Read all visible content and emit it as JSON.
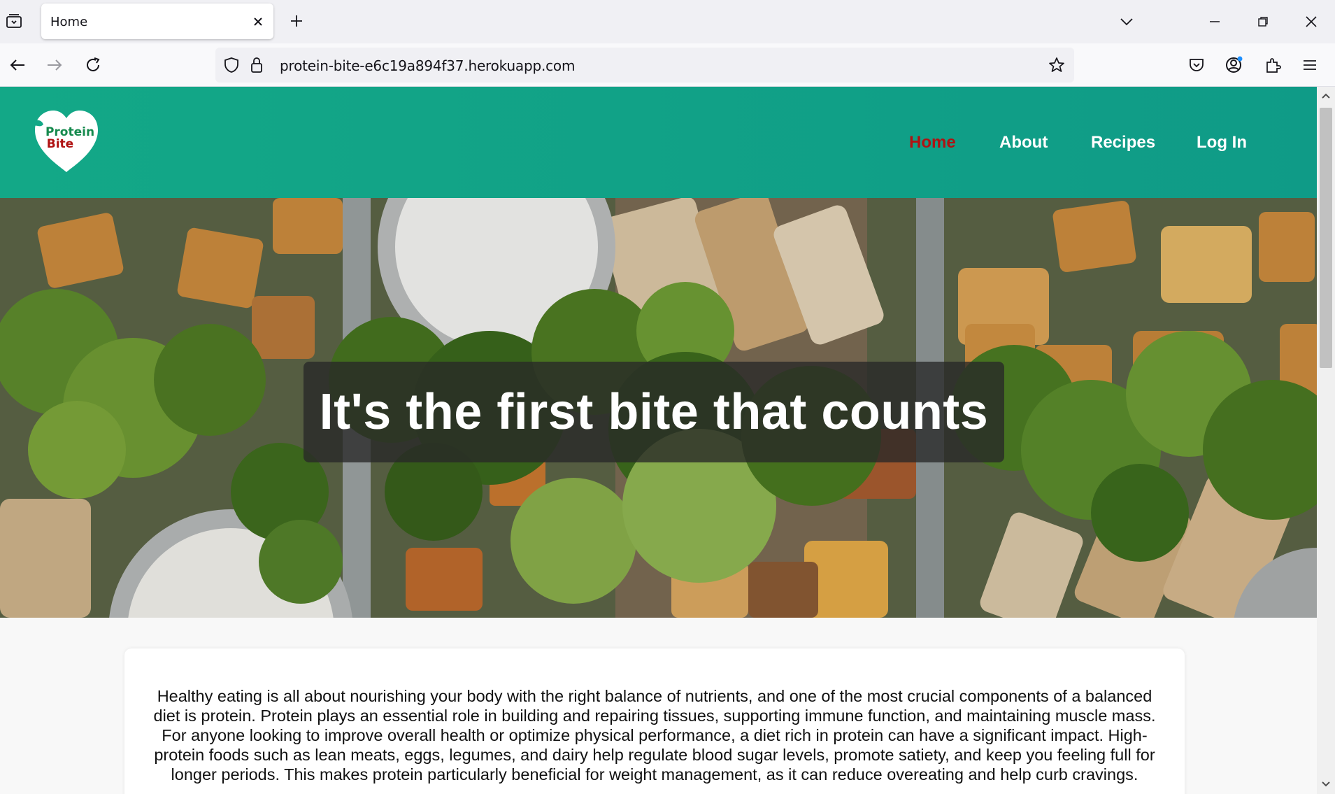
{
  "browser": {
    "tab_title": "Home",
    "url": "protein-bite-e6c19a894f37.herokuapp.com"
  },
  "site": {
    "logo": {
      "line1": "Protein",
      "line2": "Bite",
      "green": "#168a4e",
      "red": "#b01212"
    },
    "nav": [
      {
        "label": "Home",
        "active": true
      },
      {
        "label": "About",
        "active": false
      },
      {
        "label": "Recipes",
        "active": false
      },
      {
        "label": "Log In",
        "active": false
      }
    ],
    "hero_heading": "It's the first bite that counts",
    "intro_text": "Healthy eating is all about nourishing your body with the right balance of nutrients, and one of the most crucial components of a balanced diet is protein. Protein plays an essential role in building and repairing tissues, supporting immune function, and maintaining muscle mass. For anyone looking to improve overall health or optimize physical performance, a diet rich in protein can have a significant impact. High-protein foods such as lean meats, eggs, legumes, and dairy help regulate blood sugar levels, promote satiety, and keep you feeling full for longer periods. This makes protein particularly beneficial for weight management, as it can reduce overeating and help curb cravings."
  },
  "colors": {
    "header_teal": "#13a887",
    "active_nav": "#b01212",
    "page_bg": "#f8f8f8"
  }
}
